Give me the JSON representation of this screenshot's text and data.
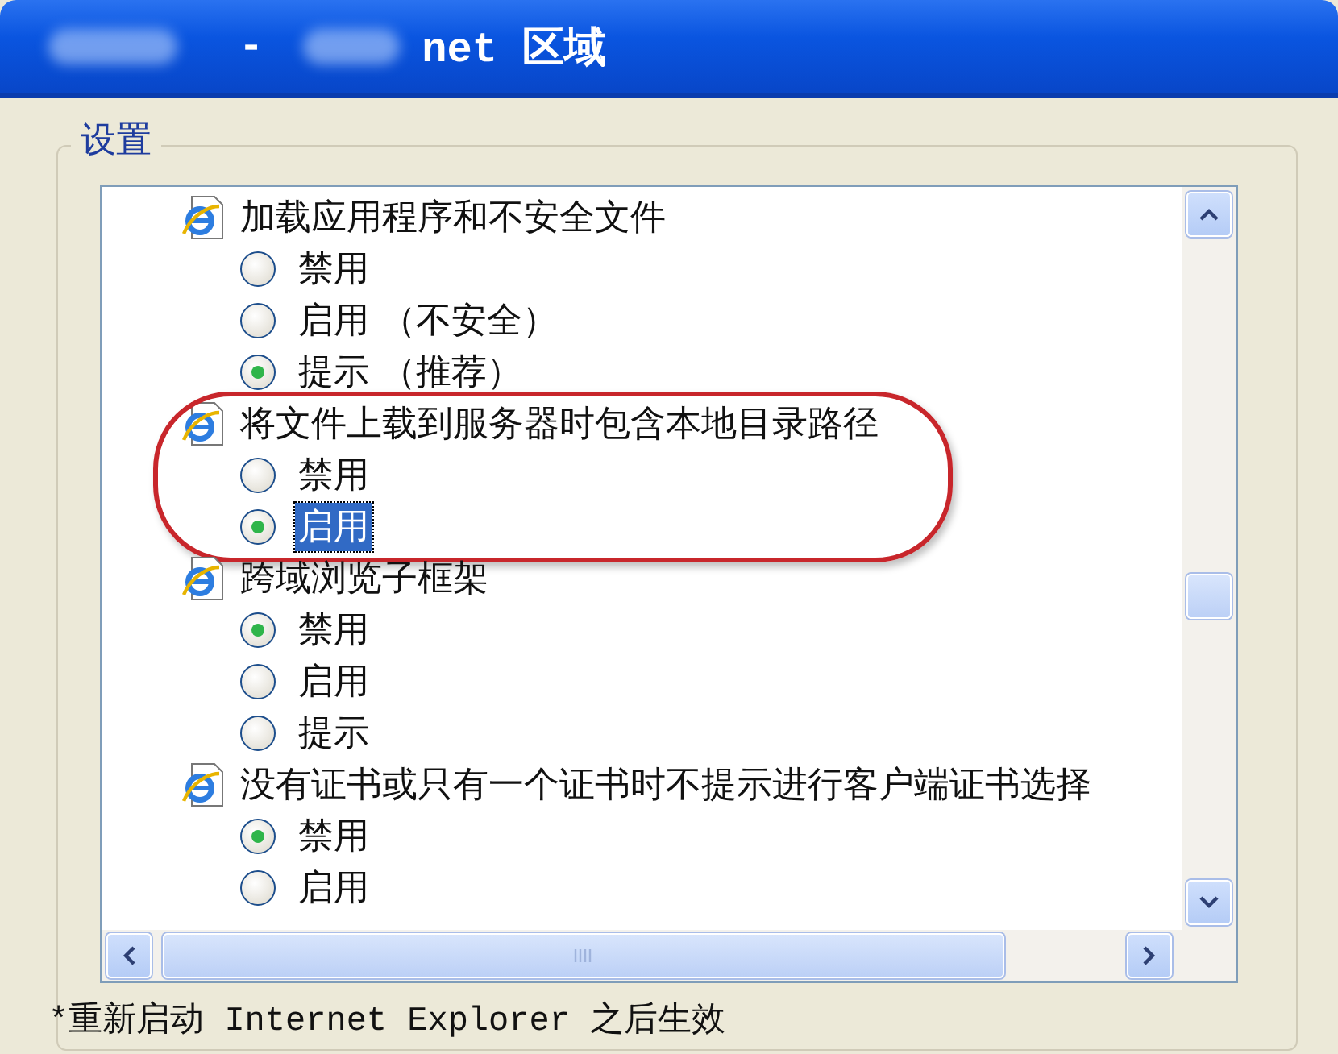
{
  "window": {
    "title_parts": [
      "-",
      "net 区域"
    ]
  },
  "settings_group": {
    "label": "设置"
  },
  "groups": [
    {
      "title": "加载应用程序和不安全文件",
      "options": [
        {
          "label": "禁用",
          "selected": false,
          "focused": false
        },
        {
          "label": "启用 （不安全）",
          "selected": false,
          "focused": false
        },
        {
          "label": "提示 （推荐）",
          "selected": true,
          "focused": false
        }
      ]
    },
    {
      "title": "将文件上载到服务器时包含本地目录路径",
      "highlighted": true,
      "options": [
        {
          "label": "禁用",
          "selected": false,
          "focused": false
        },
        {
          "label": "启用",
          "selected": true,
          "focused": true
        }
      ]
    },
    {
      "title": "跨域浏览子框架",
      "options": [
        {
          "label": "禁用",
          "selected": true,
          "focused": false
        },
        {
          "label": "启用",
          "selected": false,
          "focused": false
        },
        {
          "label": "提示",
          "selected": false,
          "focused": false
        }
      ]
    },
    {
      "title": "没有证书或只有一个证书时不提示进行客户端证书选择",
      "options": [
        {
          "label": "禁用",
          "selected": true,
          "focused": false
        },
        {
          "label": "启用",
          "selected": false,
          "focused": false
        }
      ]
    }
  ],
  "footer_note": "*重新启动 Internet Explorer 之后生效"
}
